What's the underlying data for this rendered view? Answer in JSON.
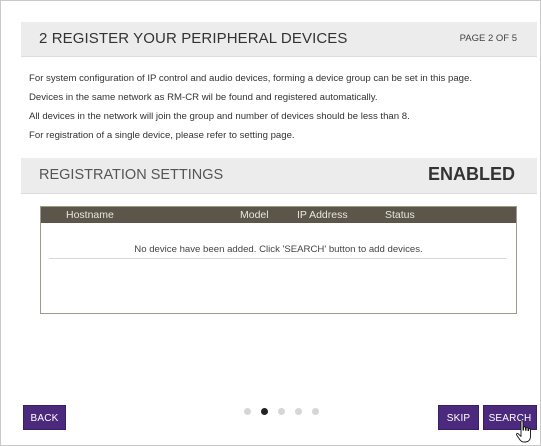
{
  "header": {
    "title": "2 REGISTER YOUR PERIPHERAL DEVICES",
    "page_indicator": "PAGE 2 OF 5"
  },
  "description": [
    "For system configuration of IP control and audio devices, forming a device group can be set in this page.",
    "Devices in the same network as RM-CR wil be found and registered automatically.",
    "All devices in the network will join the group and number of devices should be less than 8.",
    "For registration of a single device, please refer to setting page."
  ],
  "registration": {
    "title": "REGISTRATION SETTINGS",
    "status": "ENABLED"
  },
  "table": {
    "columns": [
      "Hostname",
      "Model",
      "IP Address",
      "Status"
    ],
    "empty_message": "No device have been added. Click 'SEARCH' button to add devices."
  },
  "pagination": {
    "total": 5,
    "current": 2
  },
  "buttons": {
    "back": "BACK",
    "skip": "SKIP",
    "search": "SEARCH"
  },
  "colors": {
    "button_bg": "#4b2a7e",
    "table_header_bg": "#5b5649",
    "section_bar_bg": "#ececec"
  },
  "icons": {
    "cursor": "hand-pointer-icon"
  }
}
